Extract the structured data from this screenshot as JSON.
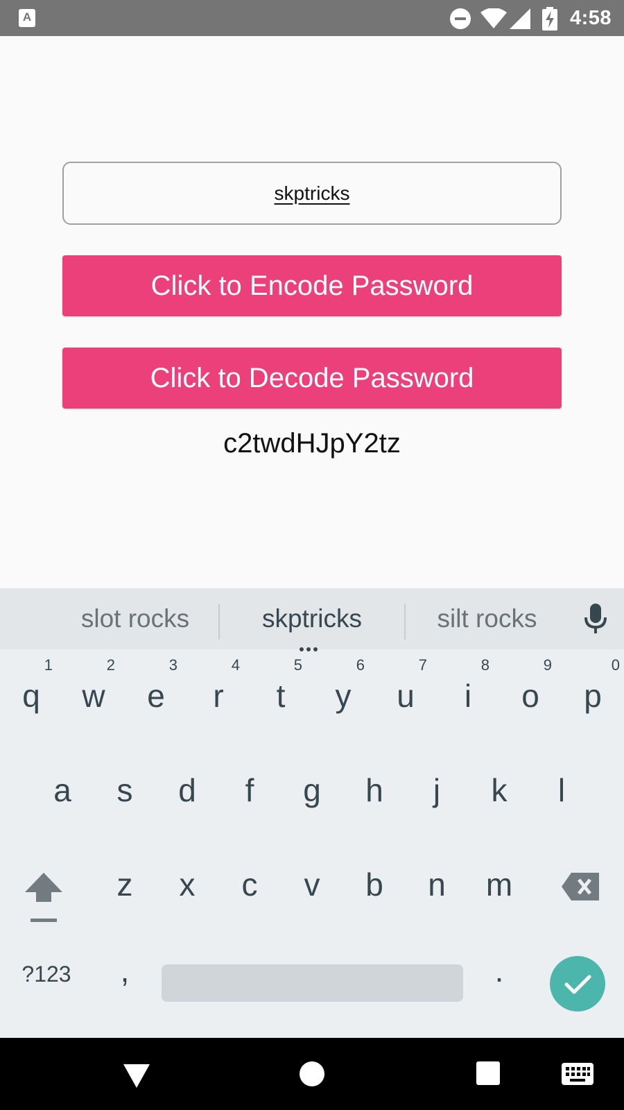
{
  "status_bar": {
    "app_icon_letter": "A",
    "icons": [
      "dnd-icon",
      "wifi-icon",
      "signal-icon",
      "battery-charging-icon"
    ],
    "time": "4:58"
  },
  "form": {
    "password_value": "skptricks",
    "encode_button_label": "Click to Encode Password",
    "decode_button_label": "Click to Decode Password",
    "result_text": "c2twdHJpY2tz"
  },
  "keyboard": {
    "suggestions": [
      "slot rocks",
      "skptricks",
      "silt rocks"
    ],
    "row1": [
      {
        "key": "q",
        "hint": "1"
      },
      {
        "key": "w",
        "hint": "2"
      },
      {
        "key": "e",
        "hint": "3"
      },
      {
        "key": "r",
        "hint": "4"
      },
      {
        "key": "t",
        "hint": "5"
      },
      {
        "key": "y",
        "hint": "6"
      },
      {
        "key": "u",
        "hint": "7"
      },
      {
        "key": "i",
        "hint": "8"
      },
      {
        "key": "o",
        "hint": "9"
      },
      {
        "key": "p",
        "hint": "0"
      }
    ],
    "row2": [
      "a",
      "s",
      "d",
      "f",
      "g",
      "h",
      "j",
      "k",
      "l"
    ],
    "row3": [
      "z",
      "x",
      "c",
      "v",
      "b",
      "n",
      "m"
    ],
    "symbols_label": "?123",
    "comma": ",",
    "period": ".",
    "colors": {
      "background": "#eceff1",
      "key_text": "#37474f",
      "done": "#4db6ac"
    }
  },
  "colors": {
    "button": "#ec407a",
    "status_bar": "#757575"
  }
}
